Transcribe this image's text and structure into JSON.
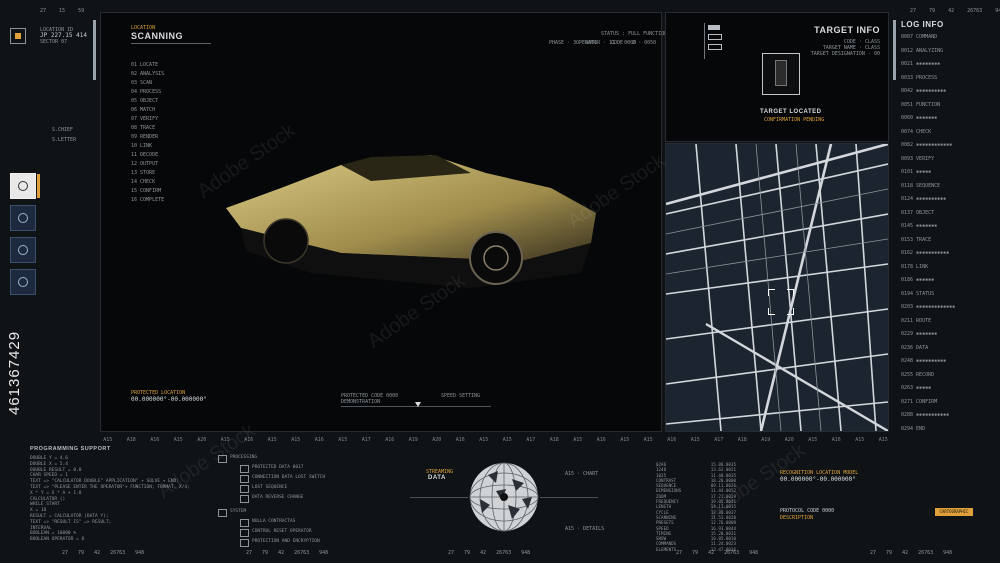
{
  "top_status": [
    "27",
    "15",
    "59",
    "27",
    "79",
    "42",
    "26763",
    "948"
  ],
  "left_panel": {
    "coords_label": "JP 227.15 414",
    "mini_lines": [
      "LOCATION ID",
      "SECTOR 07",
      "GRID 44.1"
    ],
    "side_text": [
      "S.CHIEF",
      "S.LETTER"
    ],
    "vertical_id": "461367429"
  },
  "scanning": {
    "title": "SCANNING",
    "subtitle": "LOCATION",
    "status_line": "STATUS : FULL FUNCTIONALITY",
    "readouts": [
      "PHASE · 3 · 0001",
      "OPERATOR · 11 · 0009",
      "CODE · 2 · 0050"
    ],
    "coord_label": "PROTECTED LOCATION",
    "coord_value": "00.000000°-00.000000°",
    "bottom_codes": [
      "PROTECTED CODE 0000",
      "DEMONSTRATION",
      "SPEED SETTING"
    ],
    "log_lines": [
      "01  LOCATE",
      "02  ANALYSIS",
      "03  SCAN",
      "04  PROCESS",
      "05  OBJECT",
      "06  MATCH",
      "07  VERIFY",
      "08  TRACE",
      "09  RENDER",
      "10  LINK",
      "11  DECODE",
      "12  OUTPUT",
      "13  STORE",
      "14  CHECK",
      "15  CONFIRM",
      "16  COMPLETE"
    ]
  },
  "target_info": {
    "title": "TARGET INFO",
    "rows": [
      "CODE · CLASS",
      "TARGET NAME · CLASS",
      "TARGET DESIGNATION · 00"
    ],
    "located_label": "TARGET LOCATED",
    "located_sub": "CONFIRMATION PENDING"
  },
  "log_info": {
    "title": "LOG INFO",
    "lines": [
      "0007  COMMAND",
      "0012  ANALYZING",
      "0021  ▪▪▪▪▪▪▪▪",
      "0033  PROCESS",
      "0042  ▪▪▪▪▪▪▪▪▪▪",
      "0051  FUNCTION",
      "0060  ▪▪▪▪▪▪▪",
      "0074  CHECK",
      "0082  ▪▪▪▪▪▪▪▪▪▪▪▪",
      "0093  VERIFY",
      "0101  ▪▪▪▪▪",
      "0118  SEQUENCE",
      "0124  ▪▪▪▪▪▪▪▪▪▪",
      "0137  OBJECT",
      "0145  ▪▪▪▪▪▪▪",
      "0153  TRACE",
      "0162  ▪▪▪▪▪▪▪▪▪▪▪",
      "0178  LINK",
      "0186  ▪▪▪▪▪▪",
      "0194  STATUS",
      "0203  ▪▪▪▪▪▪▪▪▪▪▪▪▪",
      "0211  ROUTE",
      "0229  ▪▪▪▪▪▪▪",
      "0236  DATA",
      "0248  ▪▪▪▪▪▪▪▪▪▪",
      "0255  RECORD",
      "0263  ▪▪▪▪▪",
      "0271  CONFIRM",
      "0288  ▪▪▪▪▪▪▪▪▪▪▪",
      "0294  END"
    ]
  },
  "ruler": [
    "A15",
    "A18",
    "A16",
    "A15",
    "A20",
    "A15",
    "A16",
    "A15",
    "A15",
    "A16",
    "A15",
    "A17",
    "A16",
    "A19",
    "A20",
    "A16",
    "A15",
    "A15",
    "A17",
    "A18",
    "A15",
    "A16",
    "A15",
    "A15",
    "A16",
    "A15",
    "A17",
    "A18",
    "A19",
    "A20",
    "A15",
    "A16",
    "A15",
    "A15"
  ],
  "programming": {
    "title": "PROGRAMMING SUPPORT",
    "lines": [
      "DOUBLE Y = 4.6",
      "DOUBLE X = 5.4",
      "DOUBLE RESULT = 0.0",
      "CHAR SPEED = 1",
      "",
      "TEXT => \"CALCULATOR DOUBLE\" APPLICATION\" + SOLVE + END;",
      "TEXT => \"PLEASE ENTER THE OPERATOR\"+ FUNCTION; FORMAT, X/4;",
      "X * Y = X * A + 1.8",
      "",
      "CALCULATOR ()",
      "WHILE START",
      "  X = 18",
      "  RESULT = CALCULATOR (DATA Y);",
      "  TEXT => \"RESULT IS\" => RESULT;",
      "",
      "INTERVAL",
      "BOOLEAN = 10000 %",
      "BOOLEAN OPERATOR = 0"
    ]
  },
  "tree": {
    "group1_title": "PROCESSING",
    "group1_items": [
      "PROTECTED DATA 0017",
      "CONNECTION DATA LOST SWITCH",
      "LOST SEQUENCE",
      "DATA REVERSE CHANGE"
    ],
    "group2_title": "SYSTEM",
    "group2_items": [
      "NULLA CONTRACTAS",
      "CONTROL RESET OPERATOR",
      "PROTECTION AND ENCRYPTION"
    ]
  },
  "globe": {
    "label_top": "STREAMING",
    "label": "DATA",
    "side_a": "A15 · CHART",
    "side_b": "A15 · DETAILS"
  },
  "data_table": {
    "rows": [
      [
        "02A6",
        "15.88.0035"
      ],
      [
        "1248",
        "13.62.0021"
      ],
      [
        "1025",
        "11.40.0035"
      ],
      [
        "CONTRAST",
        "18.20.0000"
      ],
      [
        "SEQUENCE",
        "09.11.0026"
      ],
      [
        "DIMENSIONS",
        "11.44.0052"
      ],
      [
        "ZOOM",
        "17.21.0019"
      ],
      [
        "FREQUENCY",
        "19.05.0041"
      ],
      [
        "LENGTH",
        "14.11.0015"
      ],
      [
        "CYCLE",
        "13.80.0037"
      ],
      [
        "SCANNING",
        "11.53.0020"
      ],
      [
        "PRESETS",
        "12.76.0008"
      ],
      [
        "SPEED",
        "16.93.0044"
      ],
      [
        "TIMING",
        "15.20.0031"
      ],
      [
        "SHOW",
        "10.85.0010"
      ],
      [
        "COMMANDS",
        "11.24.0023"
      ],
      [
        "ELEMENTS",
        "13.47.0016"
      ]
    ]
  },
  "right_bottom": {
    "coord_label": "RECOGNITION LOCATION MODEL",
    "coord_value": "00.000000°-00.000000°",
    "protocol": "PROTOCOL CODE 0000",
    "descr": "DESCRIPTION",
    "badge": "CARTOGRAPHIC"
  },
  "bottom_status": [
    [
      "27",
      "79",
      "42",
      "26763",
      "948"
    ],
    [
      "27",
      "79",
      "42",
      "26763",
      "948"
    ],
    [
      "27",
      "79",
      "42",
      "26763",
      "948"
    ],
    [
      "27",
      "79",
      "42",
      "26763",
      "948"
    ],
    [
      "27",
      "79",
      "42",
      "26763",
      "948"
    ]
  ],
  "watermark": "Adobe Stock",
  "colors": {
    "accent": "#e0a13a",
    "car": "#d8c47a",
    "map_bg": "#1c2430"
  }
}
